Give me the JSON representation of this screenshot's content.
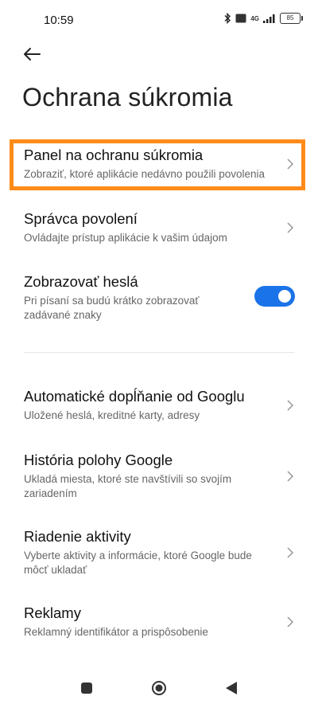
{
  "status": {
    "time": "10:59",
    "network": "4G",
    "battery": "85"
  },
  "header": {
    "title": "Ochrana súkromia"
  },
  "items": [
    {
      "title": "Panel na ochranu súkromia",
      "subtitle": "Zobraziť, ktoré aplikácie nedávno použili povolenia"
    },
    {
      "title": "Správca povolení",
      "subtitle": "Ovládajte prístup aplikácie k vašim údajom"
    },
    {
      "title": "Zobrazovať heslá",
      "subtitle": "Pri písaní sa budú krátko zobrazovať zadávané znaky",
      "toggle_on": true
    },
    {
      "title": "Automatické dopĺňanie od Googlu",
      "subtitle": "Uložené heslá, kreditné karty, adresy"
    },
    {
      "title": "História polohy Google",
      "subtitle": "Ukladá miesta, ktoré ste navštívili so svojím zariadením"
    },
    {
      "title": "Riadenie aktivity",
      "subtitle": "Vyberte aktivity a informácie, ktoré Google bude môcť ukladať"
    },
    {
      "title": "Reklamy",
      "subtitle": "Reklamný identifikátor a prispôsobenie"
    }
  ],
  "colors": {
    "accent": "#1a73e8",
    "highlight": "#ff8c1a"
  },
  "icons": [
    "back-arrow-icon",
    "chevron-right-icon",
    "bluetooth-icon",
    "signal-icon",
    "battery-icon",
    "nav-square-icon",
    "nav-home-icon",
    "nav-back-icon"
  ]
}
